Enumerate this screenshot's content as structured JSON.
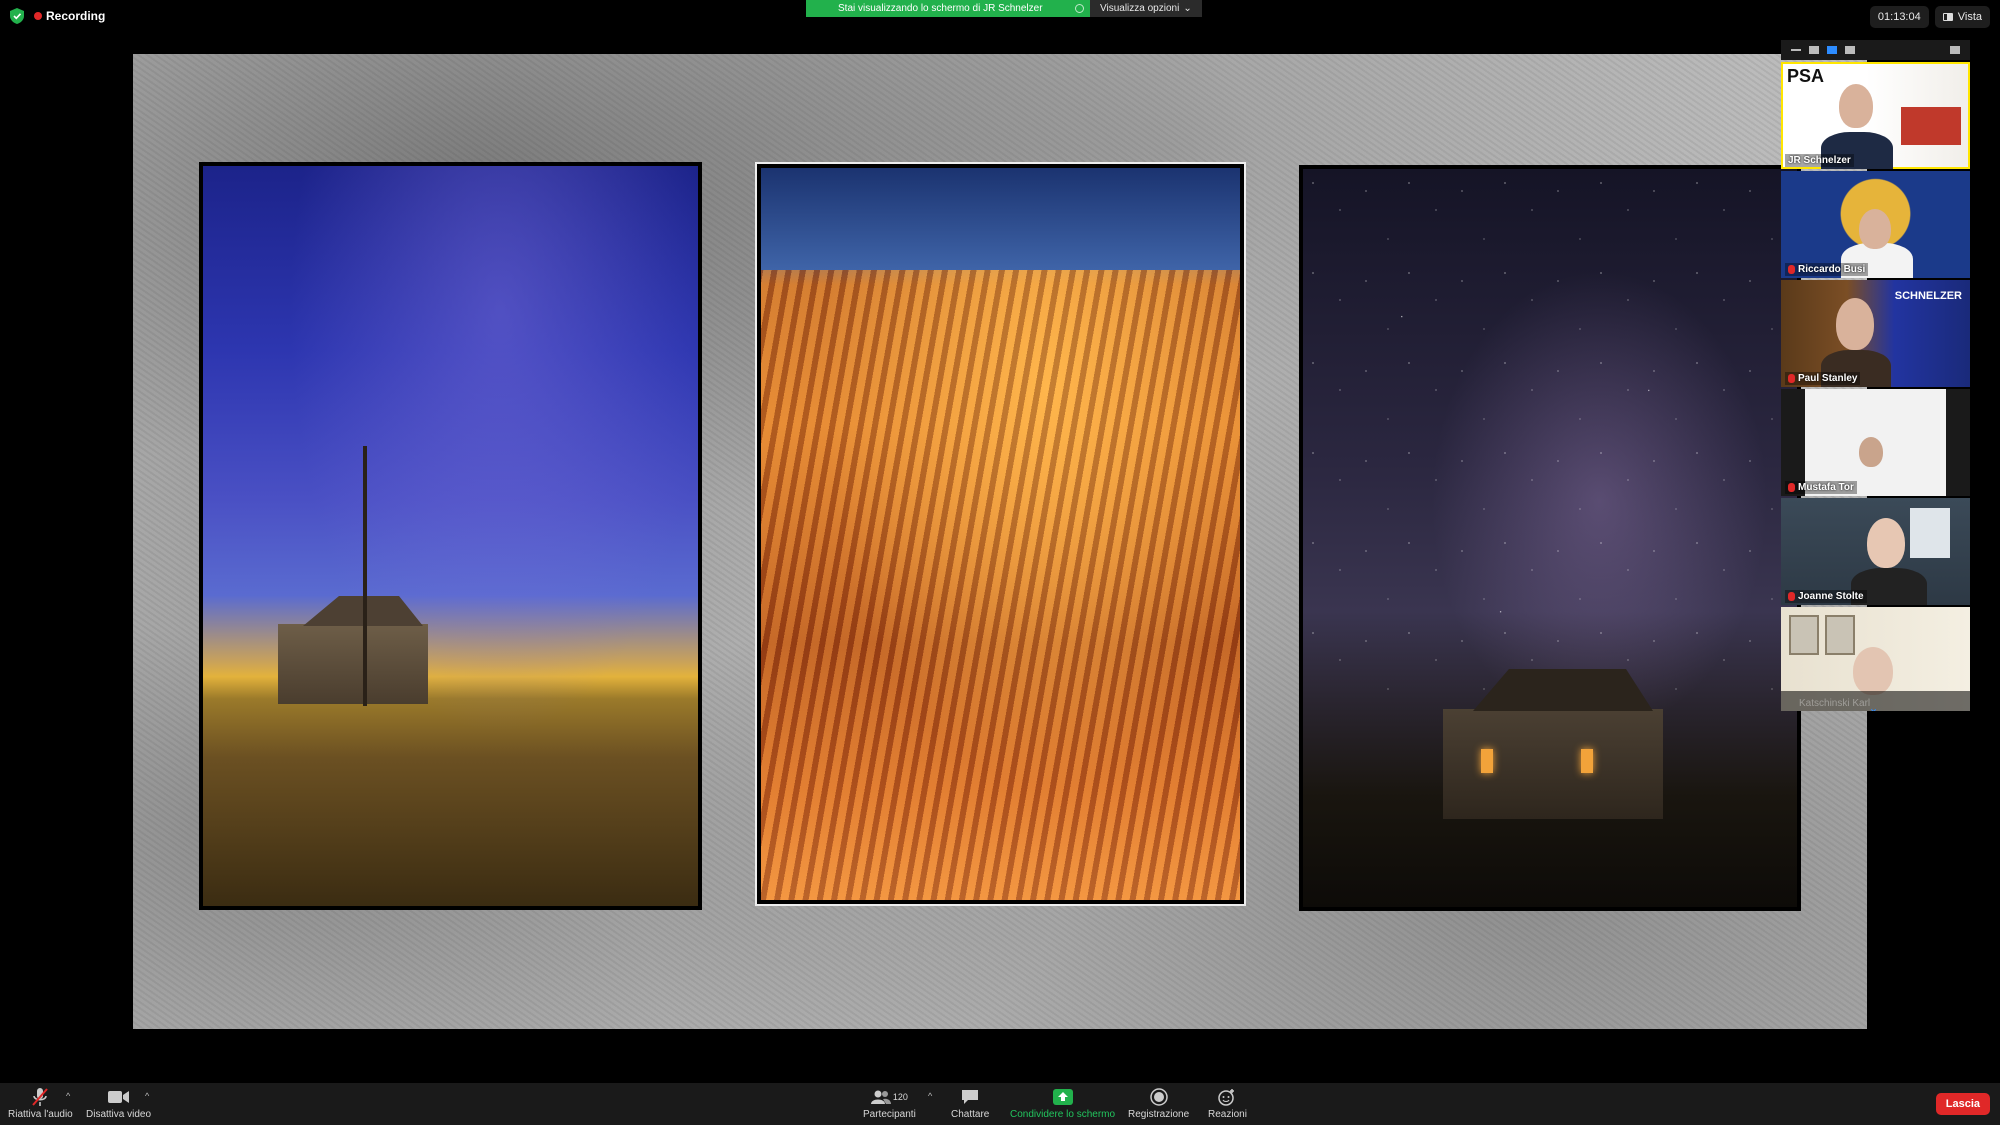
{
  "top": {
    "recording_label": "Recording",
    "share_banner": "Stai visualizzando lo schermo di JR Schnelzer",
    "view_options": "Visualizza opzioni",
    "timer": "01:13:04",
    "view_label": "Vista"
  },
  "shared_screen": {
    "photos": [
      {
        "subject": "abandoned prairie house with bare tree under blue sky"
      },
      {
        "subject": "orange sandstone wave formation"
      },
      {
        "subject": "old cabin with lit windows under milky way night sky"
      }
    ]
  },
  "participants": [
    {
      "name": "JR Schnelzer",
      "active_speaker": true,
      "muted": false,
      "logo_text": "PSA"
    },
    {
      "name": "Riccardo Busi",
      "muted": true
    },
    {
      "name": "Paul Stanley",
      "muted": true,
      "banner_text": "SCHNELZER"
    },
    {
      "name": "Mustafa Tor",
      "muted": true
    },
    {
      "name": "Joanne Stolte",
      "muted": true
    },
    {
      "name": "Katschinski Karl",
      "muted": true
    }
  ],
  "toolbar": {
    "unmute_label": "Riattiva l'audio",
    "stop_video_label": "Disattiva video",
    "participants_label": "Partecipanti",
    "participants_count": "120",
    "chat_label": "Chattare",
    "share_label": "Condividere lo schermo",
    "record_label": "Registrazione",
    "reactions_label": "Reazioni",
    "leave_label": "Lascia"
  },
  "colors": {
    "accent_green": "#22b14c",
    "leave_red": "#e02828",
    "active_speaker": "#ffe600",
    "view_active_blue": "#2d8cff"
  }
}
